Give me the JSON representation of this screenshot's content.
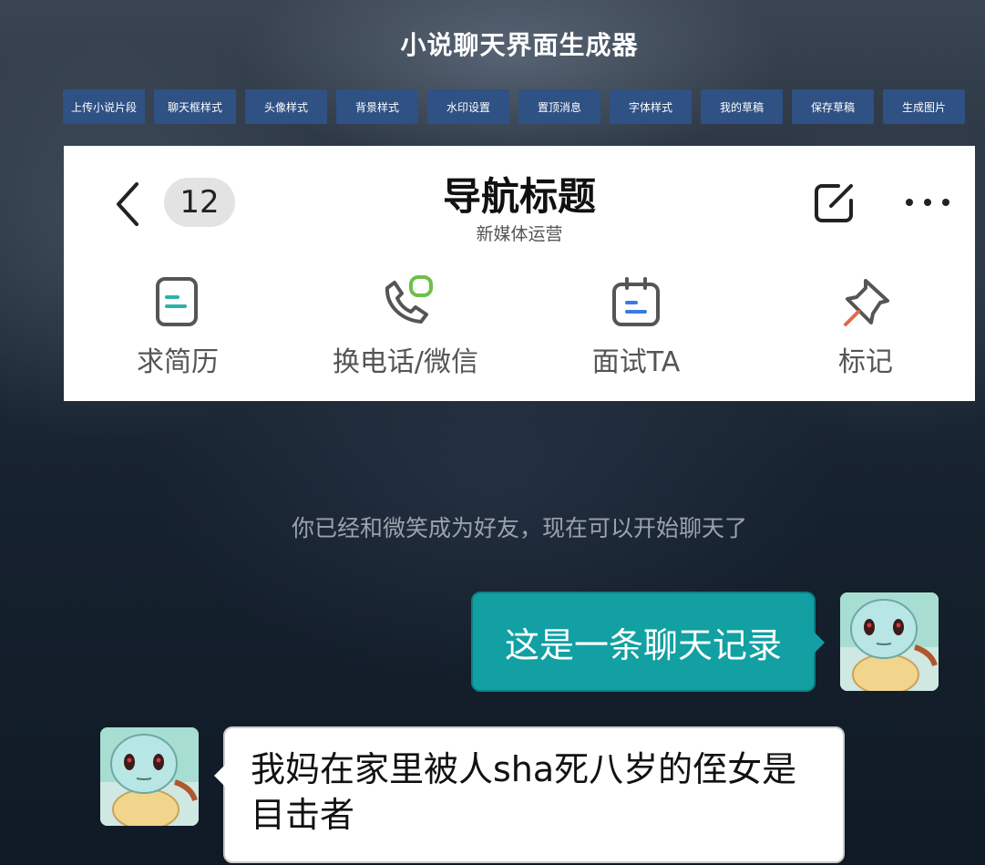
{
  "app": {
    "title": "小说聊天界面生成器"
  },
  "toolbar": {
    "buttons": [
      {
        "label": "上传小说片段"
      },
      {
        "label": "聊天框样式"
      },
      {
        "label": "头像样式"
      },
      {
        "label": "背景样式"
      },
      {
        "label": "水印设置"
      },
      {
        "label": "置顶消息"
      },
      {
        "label": "字体样式"
      },
      {
        "label": "我的草稿"
      },
      {
        "label": "保存草稿"
      },
      {
        "label": "生成图片"
      }
    ]
  },
  "header": {
    "unread_count": "12",
    "title": "导航标题",
    "subtitle": "新媒体运营",
    "actions": [
      {
        "label": "求简历",
        "icon": "resume-icon"
      },
      {
        "label": "换电话/微信",
        "icon": "phone-wechat-icon"
      },
      {
        "label": "面试TA",
        "icon": "calendar-icon"
      },
      {
        "label": "标记",
        "icon": "pin-icon"
      }
    ]
  },
  "chat": {
    "system_message": "你已经和微笑成为好友，现在可以开始聊天了",
    "messages": [
      {
        "side": "right",
        "text": "这是一条聊天记录"
      },
      {
        "side": "left",
        "text": "我妈在家里被人sha死八岁的侄女是目击者"
      }
    ]
  },
  "colors": {
    "toolbar_button": "#2f5184",
    "outgoing_bubble": "#12a0a3",
    "incoming_bubble": "#ffffff"
  }
}
